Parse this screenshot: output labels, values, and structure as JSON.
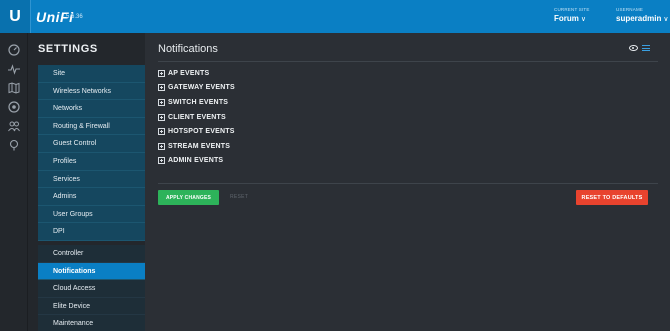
{
  "header": {
    "logo_glyph": "U",
    "brand": "UniFi",
    "version": "5.6.36",
    "site_label": "CURRENT SITE",
    "site_value": "Forum",
    "user_label": "USERNAME",
    "user_value": "superadmin",
    "accent_color": "#0a7fc4"
  },
  "rail": {
    "icons": [
      "dashboard-icon",
      "statistics-icon",
      "map-icon",
      "devices-icon",
      "clients-icon",
      "insights-icon"
    ]
  },
  "settings": {
    "title": "SETTINGS",
    "items": [
      {
        "label": "Site"
      },
      {
        "label": "Wireless Networks"
      },
      {
        "label": "Networks"
      },
      {
        "label": "Routing & Firewall"
      },
      {
        "label": "Guest Control"
      },
      {
        "label": "Profiles"
      },
      {
        "label": "Services"
      },
      {
        "label": "Admins"
      },
      {
        "label": "User Groups"
      },
      {
        "label": "DPI"
      },
      {
        "label": "Controller"
      },
      {
        "label": "Notifications"
      },
      {
        "label": "Cloud Access"
      },
      {
        "label": "Elite Device"
      },
      {
        "label": "Maintenance"
      }
    ],
    "active": "Notifications"
  },
  "main": {
    "title": "Notifications",
    "events": [
      {
        "label": "AP EVENTS"
      },
      {
        "label": "GATEWAY EVENTS"
      },
      {
        "label": "SWITCH EVENTS"
      },
      {
        "label": "CLIENT EVENTS"
      },
      {
        "label": "HOTSPOT EVENTS"
      },
      {
        "label": "STREAM EVENTS"
      },
      {
        "label": "ADMIN EVENTS"
      }
    ],
    "apply_label": "APPLY CHANGES",
    "reset_label": "RESET",
    "defaults_label": "RESET TO DEFAULTS",
    "apply_color": "#2db35a",
    "defaults_color": "#e8432e"
  }
}
